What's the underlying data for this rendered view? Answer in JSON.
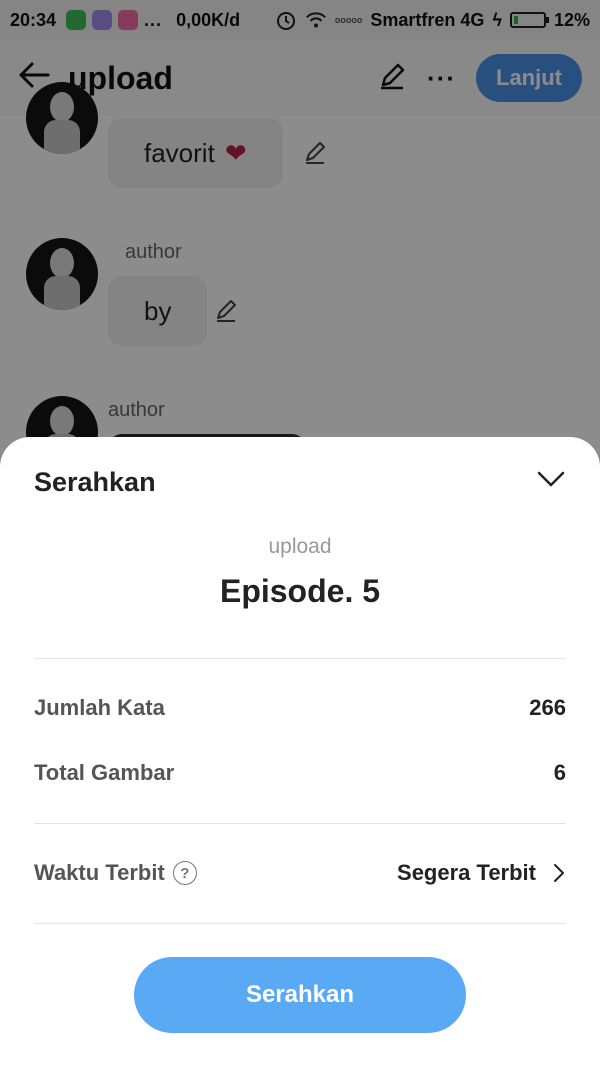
{
  "statusbar": {
    "time": "20:34",
    "overflow": "...",
    "net_speed": "0,00K/d",
    "carrier": "Smartfren 4G",
    "battery": "12%"
  },
  "toolbar": {
    "title": "upload",
    "next_label": "Lanjut",
    "more_label": "···"
  },
  "chat": {
    "messages": [
      {
        "author": "",
        "text": "favorit"
      },
      {
        "author": "author",
        "text": "by"
      },
      {
        "author": "author",
        "text": ""
      }
    ]
  },
  "sheet": {
    "title": "Serahkan",
    "subtitle": "upload",
    "episode": "Episode. 5",
    "rows": [
      {
        "label": "Jumlah Kata",
        "value": "266"
      },
      {
        "label": "Total Gambar",
        "value": "6"
      }
    ],
    "publish": {
      "label": "Waktu Terbit",
      "value": "Segera Terbit",
      "help": "?"
    },
    "submit_label": "Serahkan"
  },
  "colors": {
    "accent": "#5aa9f5",
    "toolbar_button": "#4a93e8",
    "heart": "#b31f4f",
    "overlay": "rgba(0,0,0,0.45)"
  },
  "icons": [
    "back-arrow-icon",
    "edit-icon",
    "more-icon",
    "heart-icon",
    "chevron-down-icon",
    "help-icon",
    "chevron-right-icon",
    "wifi-icon",
    "alarm-icon",
    "battery-icon"
  ]
}
